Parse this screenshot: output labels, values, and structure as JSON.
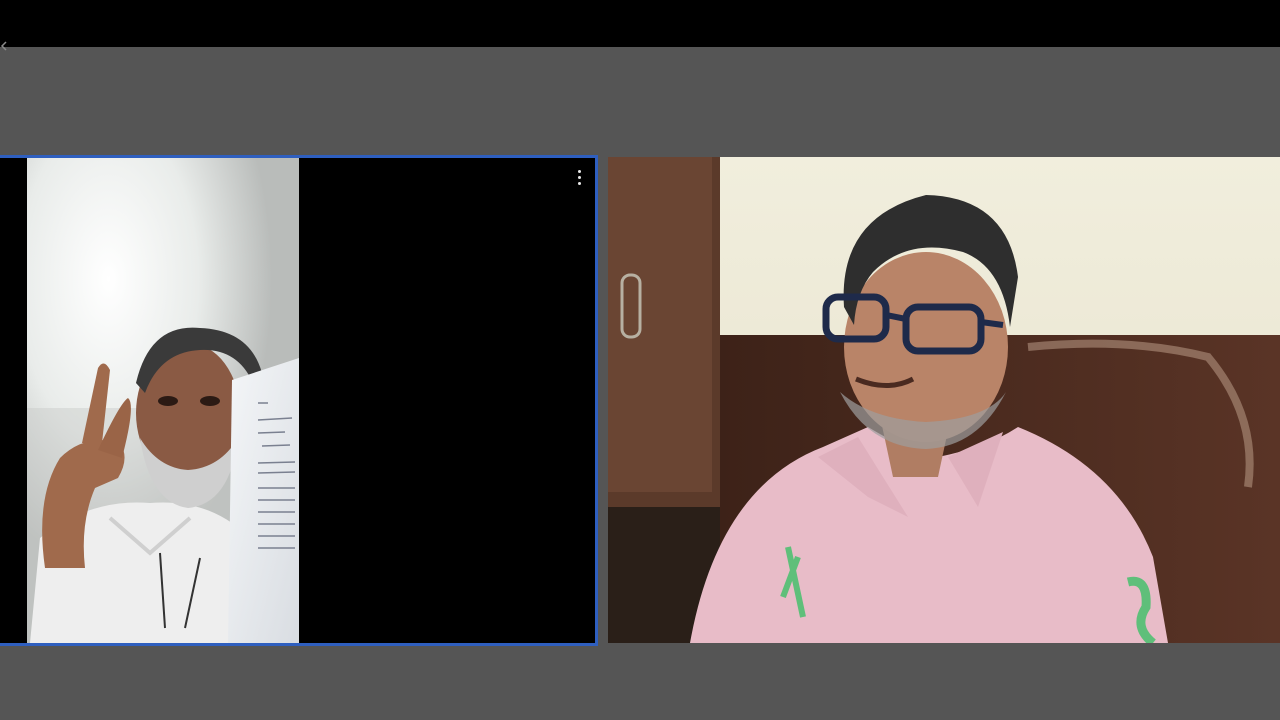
{
  "call": {
    "participants": [
      {
        "tile": "left",
        "active_speaker": true,
        "highlight_color": "#2f5fbf"
      },
      {
        "tile": "right",
        "active_speaker": false
      }
    ]
  },
  "icons": {
    "more_options": "more-vertical-icon",
    "back": "back-arrow-icon"
  }
}
